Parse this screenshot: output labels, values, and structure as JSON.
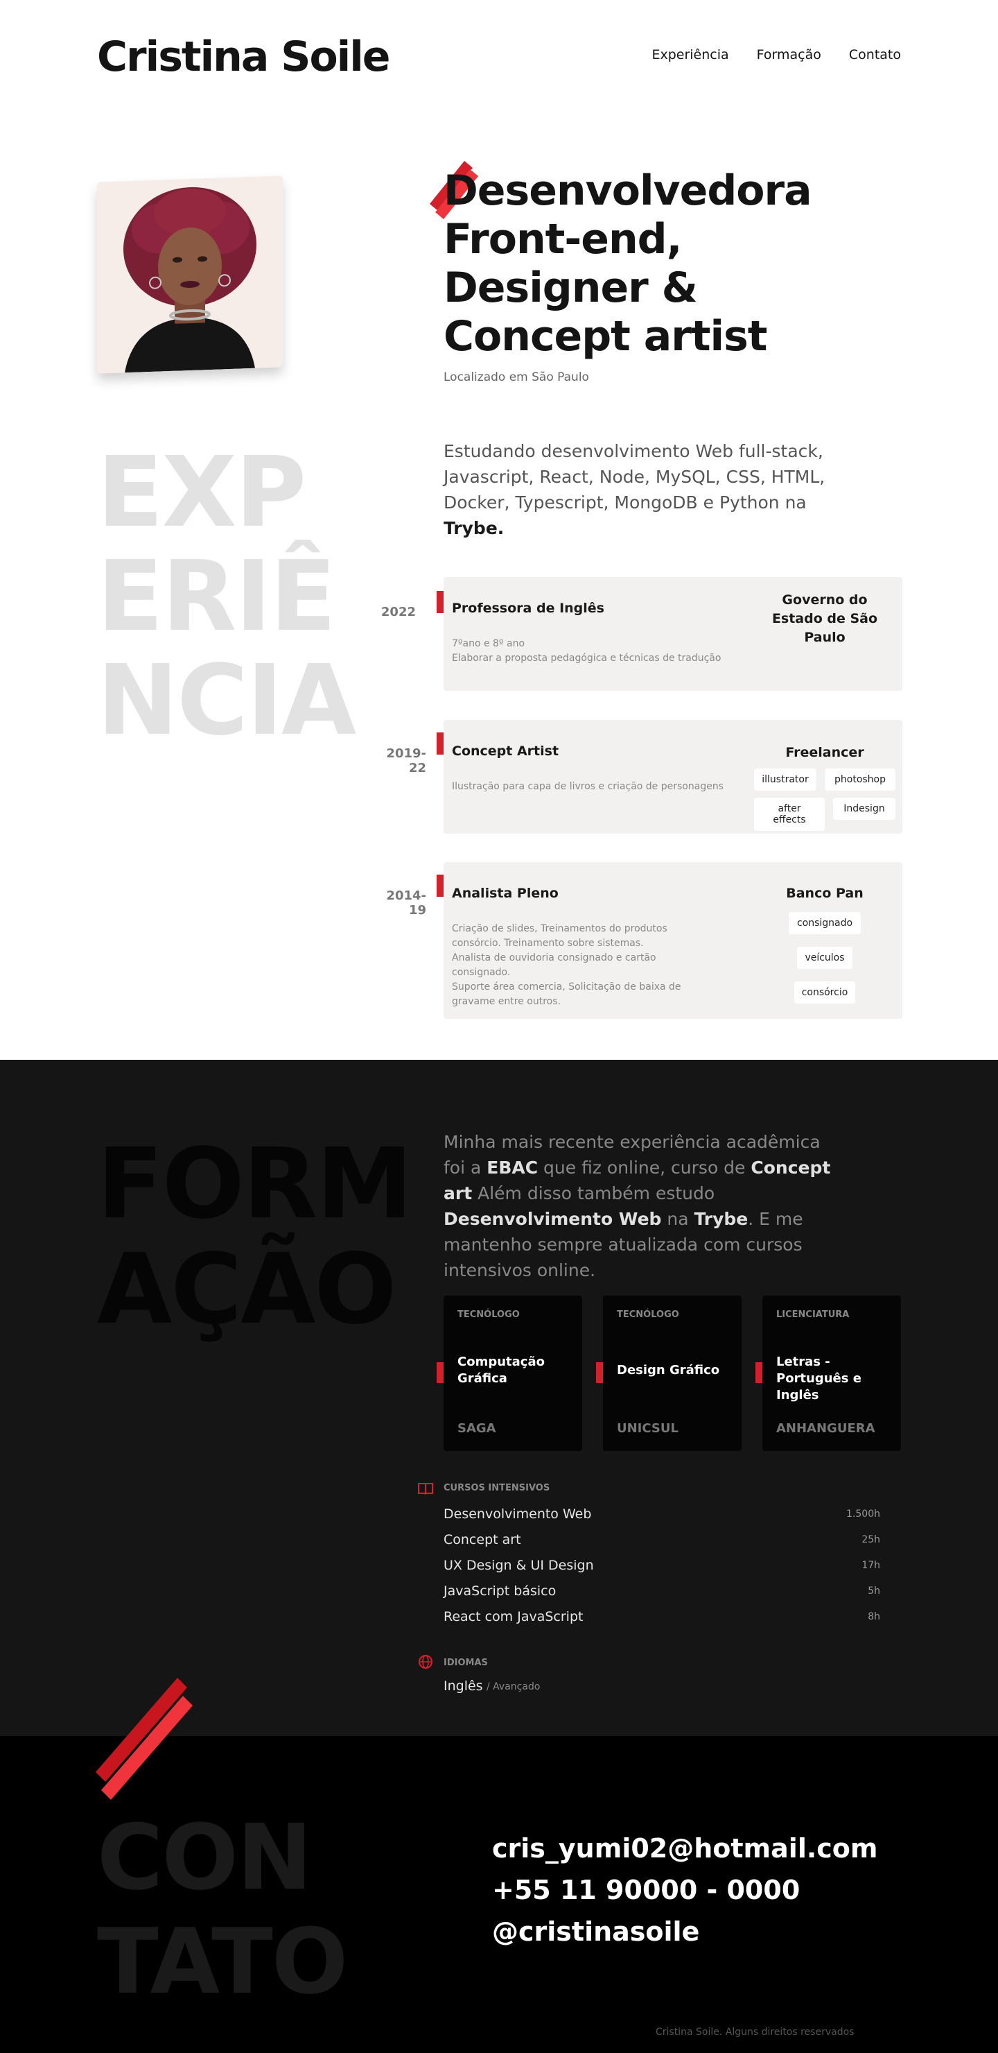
{
  "header": {
    "brand": "Cristina Soile",
    "nav": [
      "Experiência",
      "Formação",
      "Contato"
    ]
  },
  "hero": {
    "title_lines": [
      "Desenvolvedora",
      "Front-end,",
      "Designer &",
      "Concept artist"
    ],
    "location": "Localizado em São Paulo"
  },
  "intro": {
    "text": "Estudando desenvolvimento Web full-stack, Javascript, React, Node, MySQL, CSS, HTML, Docker, Typescript, MongoDB e Python na",
    "highlight": "Trybe."
  },
  "experience": {
    "heading_lines": [
      "EXP",
      "ERIÊ",
      "NCIA"
    ],
    "items": [
      {
        "year": "2022",
        "title": "Professora de Inglês",
        "description": [
          "7ºano e 8º ano",
          "Elaborar a proposta pedagógica e técnicas de tradução"
        ],
        "company": "Governo do Estado de São Paulo",
        "tags": []
      },
      {
        "year": "2019-22",
        "title": "Concept Artist",
        "description": [
          "Ilustração para capa de livros e criação de personagens"
        ],
        "company": "Freelancer",
        "tags": [
          "illustrator",
          "photoshop",
          "after effects",
          "Indesign"
        ]
      },
      {
        "year": "2014-19",
        "title": "Analista Pleno",
        "description": [
          "Criação de slides, Treinamentos do produtos",
          "consórcio. Treinamento sobre sistemas.",
          "Analista de ouvidoria consignado e cartão",
          "consignado.",
          "Suporte área comercia, Solicitação de baixa de",
          "gravame entre outros."
        ],
        "company": "Banco Pan",
        "tags": [
          "consignado",
          "veículos",
          "consórcio"
        ]
      }
    ]
  },
  "education": {
    "heading_lines": [
      "FORM",
      "AÇÃO"
    ],
    "intro": {
      "p1": "Minha mais recente experiência acadêmica foi a ",
      "b1": "EBAC",
      "p2": " que fiz online, curso de ",
      "b2": "Concept art",
      "p3": " Além disso também estudo ",
      "b3": "Desenvolvimento Web",
      "p4": " na ",
      "b4": "Trybe",
      "p5": ". E me mantenho sempre atualizada com cursos intensivos online."
    },
    "cards": [
      {
        "type": "TECNÓLOGO",
        "title": "Computação Gráfica",
        "school": "SAGA"
      },
      {
        "type": "TECNÓLOGO",
        "title": "Design Gráfico",
        "school": "UNICSUL"
      },
      {
        "type": "LICENCIATURA",
        "title": "Letras - Português e Inglês",
        "school": "ANHANGUERA"
      }
    ],
    "courses_label": "CURSOS INTENSIVOS",
    "courses": [
      {
        "name": "Desenvolvimento Web",
        "hours": "1.500h"
      },
      {
        "name": "Concept art",
        "hours": "25h"
      },
      {
        "name": "UX Design & UI Design",
        "hours": "17h"
      },
      {
        "name": "JavaScript básico",
        "hours": "5h"
      },
      {
        "name": "React com JavaScript",
        "hours": "8h"
      }
    ],
    "languages_label": "IDIOMAS",
    "language": {
      "name": "Inglês",
      "level": "/ Avançado"
    }
  },
  "contact": {
    "heading_lines": [
      "CON",
      "TATO"
    ],
    "email": "cris_yumi02@hotmail.com",
    "phone": "+55 11 90000 - 0000",
    "handle": "@cristinasoile",
    "footer": "Cristina Soile. Alguns direitos reservados"
  },
  "colors": {
    "accent": "#d3202a",
    "dark_bg": "#151515",
    "contact_bg": "#000000",
    "card_bg": "#f3f1ef"
  },
  "icons": {
    "courses": "book-icon",
    "languages": "globe-icon"
  }
}
